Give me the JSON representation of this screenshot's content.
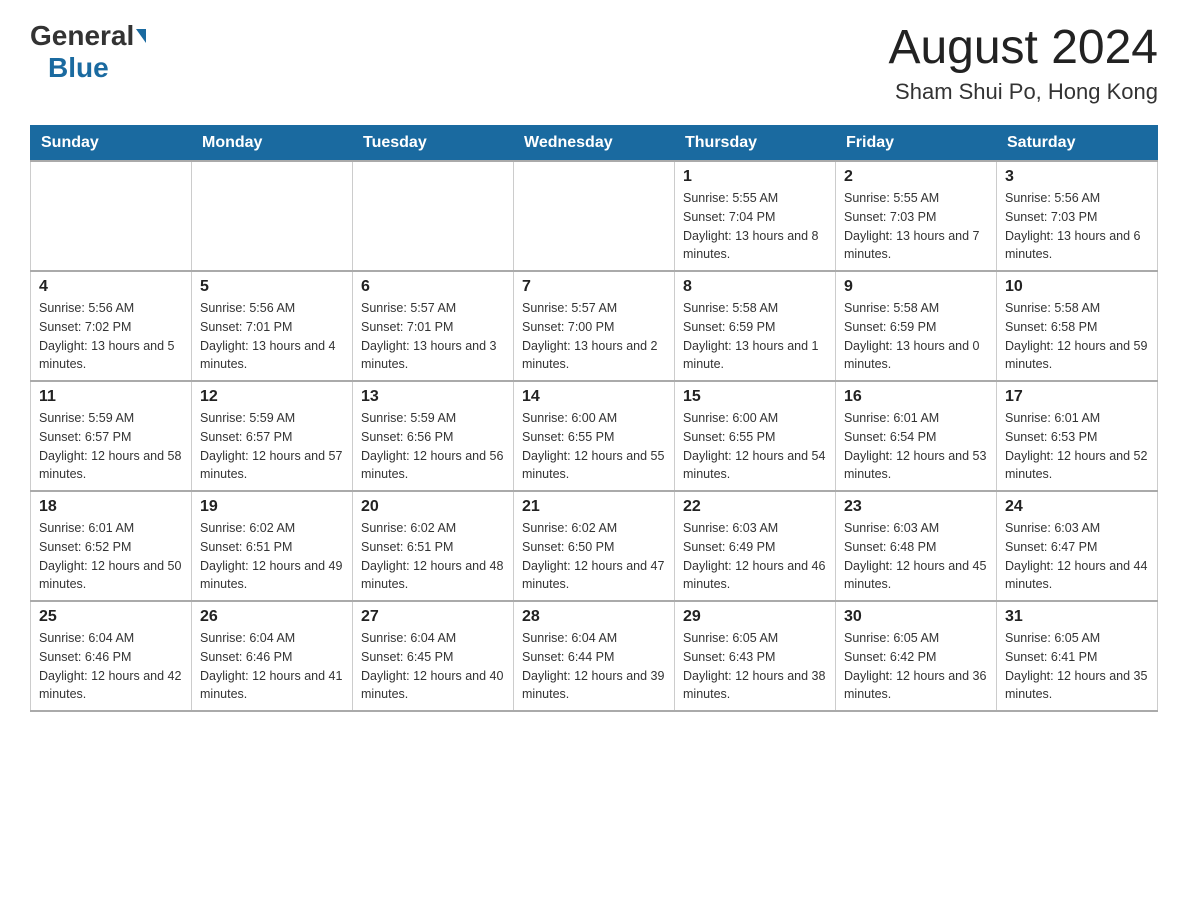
{
  "header": {
    "logo_general": "General",
    "logo_blue": "Blue",
    "month_year": "August 2024",
    "location": "Sham Shui Po, Hong Kong"
  },
  "days_of_week": [
    "Sunday",
    "Monday",
    "Tuesday",
    "Wednesday",
    "Thursday",
    "Friday",
    "Saturday"
  ],
  "weeks": [
    [
      {
        "day": "",
        "info": ""
      },
      {
        "day": "",
        "info": ""
      },
      {
        "day": "",
        "info": ""
      },
      {
        "day": "",
        "info": ""
      },
      {
        "day": "1",
        "info": "Sunrise: 5:55 AM\nSunset: 7:04 PM\nDaylight: 13 hours and 8 minutes."
      },
      {
        "day": "2",
        "info": "Sunrise: 5:55 AM\nSunset: 7:03 PM\nDaylight: 13 hours and 7 minutes."
      },
      {
        "day": "3",
        "info": "Sunrise: 5:56 AM\nSunset: 7:03 PM\nDaylight: 13 hours and 6 minutes."
      }
    ],
    [
      {
        "day": "4",
        "info": "Sunrise: 5:56 AM\nSunset: 7:02 PM\nDaylight: 13 hours and 5 minutes."
      },
      {
        "day": "5",
        "info": "Sunrise: 5:56 AM\nSunset: 7:01 PM\nDaylight: 13 hours and 4 minutes."
      },
      {
        "day": "6",
        "info": "Sunrise: 5:57 AM\nSunset: 7:01 PM\nDaylight: 13 hours and 3 minutes."
      },
      {
        "day": "7",
        "info": "Sunrise: 5:57 AM\nSunset: 7:00 PM\nDaylight: 13 hours and 2 minutes."
      },
      {
        "day": "8",
        "info": "Sunrise: 5:58 AM\nSunset: 6:59 PM\nDaylight: 13 hours and 1 minute."
      },
      {
        "day": "9",
        "info": "Sunrise: 5:58 AM\nSunset: 6:59 PM\nDaylight: 13 hours and 0 minutes."
      },
      {
        "day": "10",
        "info": "Sunrise: 5:58 AM\nSunset: 6:58 PM\nDaylight: 12 hours and 59 minutes."
      }
    ],
    [
      {
        "day": "11",
        "info": "Sunrise: 5:59 AM\nSunset: 6:57 PM\nDaylight: 12 hours and 58 minutes."
      },
      {
        "day": "12",
        "info": "Sunrise: 5:59 AM\nSunset: 6:57 PM\nDaylight: 12 hours and 57 minutes."
      },
      {
        "day": "13",
        "info": "Sunrise: 5:59 AM\nSunset: 6:56 PM\nDaylight: 12 hours and 56 minutes."
      },
      {
        "day": "14",
        "info": "Sunrise: 6:00 AM\nSunset: 6:55 PM\nDaylight: 12 hours and 55 minutes."
      },
      {
        "day": "15",
        "info": "Sunrise: 6:00 AM\nSunset: 6:55 PM\nDaylight: 12 hours and 54 minutes."
      },
      {
        "day": "16",
        "info": "Sunrise: 6:01 AM\nSunset: 6:54 PM\nDaylight: 12 hours and 53 minutes."
      },
      {
        "day": "17",
        "info": "Sunrise: 6:01 AM\nSunset: 6:53 PM\nDaylight: 12 hours and 52 minutes."
      }
    ],
    [
      {
        "day": "18",
        "info": "Sunrise: 6:01 AM\nSunset: 6:52 PM\nDaylight: 12 hours and 50 minutes."
      },
      {
        "day": "19",
        "info": "Sunrise: 6:02 AM\nSunset: 6:51 PM\nDaylight: 12 hours and 49 minutes."
      },
      {
        "day": "20",
        "info": "Sunrise: 6:02 AM\nSunset: 6:51 PM\nDaylight: 12 hours and 48 minutes."
      },
      {
        "day": "21",
        "info": "Sunrise: 6:02 AM\nSunset: 6:50 PM\nDaylight: 12 hours and 47 minutes."
      },
      {
        "day": "22",
        "info": "Sunrise: 6:03 AM\nSunset: 6:49 PM\nDaylight: 12 hours and 46 minutes."
      },
      {
        "day": "23",
        "info": "Sunrise: 6:03 AM\nSunset: 6:48 PM\nDaylight: 12 hours and 45 minutes."
      },
      {
        "day": "24",
        "info": "Sunrise: 6:03 AM\nSunset: 6:47 PM\nDaylight: 12 hours and 44 minutes."
      }
    ],
    [
      {
        "day": "25",
        "info": "Sunrise: 6:04 AM\nSunset: 6:46 PM\nDaylight: 12 hours and 42 minutes."
      },
      {
        "day": "26",
        "info": "Sunrise: 6:04 AM\nSunset: 6:46 PM\nDaylight: 12 hours and 41 minutes."
      },
      {
        "day": "27",
        "info": "Sunrise: 6:04 AM\nSunset: 6:45 PM\nDaylight: 12 hours and 40 minutes."
      },
      {
        "day": "28",
        "info": "Sunrise: 6:04 AM\nSunset: 6:44 PM\nDaylight: 12 hours and 39 minutes."
      },
      {
        "day": "29",
        "info": "Sunrise: 6:05 AM\nSunset: 6:43 PM\nDaylight: 12 hours and 38 minutes."
      },
      {
        "day": "30",
        "info": "Sunrise: 6:05 AM\nSunset: 6:42 PM\nDaylight: 12 hours and 36 minutes."
      },
      {
        "day": "31",
        "info": "Sunrise: 6:05 AM\nSunset: 6:41 PM\nDaylight: 12 hours and 35 minutes."
      }
    ]
  ]
}
